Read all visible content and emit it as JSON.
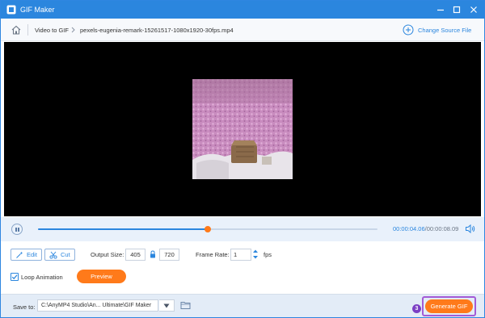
{
  "window": {
    "title": "GIF Maker"
  },
  "breadcrumb": {
    "root": "Video to GIF",
    "file": "pexels-eugenia-remark-15261517-1080x1920-30fps.mp4",
    "change_source": "Change Source File"
  },
  "player": {
    "current_time": "00:00:04.06",
    "separator": "/",
    "total_time": "00:00:08.09",
    "progress_fraction": 0.5
  },
  "controls": {
    "edit_label": "Edit",
    "cut_label": "Cut",
    "output_size_label": "Output Size:",
    "width_value": "405",
    "height_value": "720",
    "frame_rate_label": "Frame Rate:",
    "frame_rate_value": "1",
    "fps_unit": "fps",
    "loop_label": "Loop Animation",
    "loop_checked": true,
    "preview_label": "Preview"
  },
  "footer": {
    "save_to_label": "Save to:",
    "path_value": "C:\\AnyMP4 Studio\\An... Ultimate\\GIF Maker",
    "step_badge": "3",
    "generate_label": "Generate GIF"
  },
  "colors": {
    "accent_blue": "#2b86de",
    "orange": "#ff7a1a",
    "highlight_purple": "#a35bd6"
  }
}
